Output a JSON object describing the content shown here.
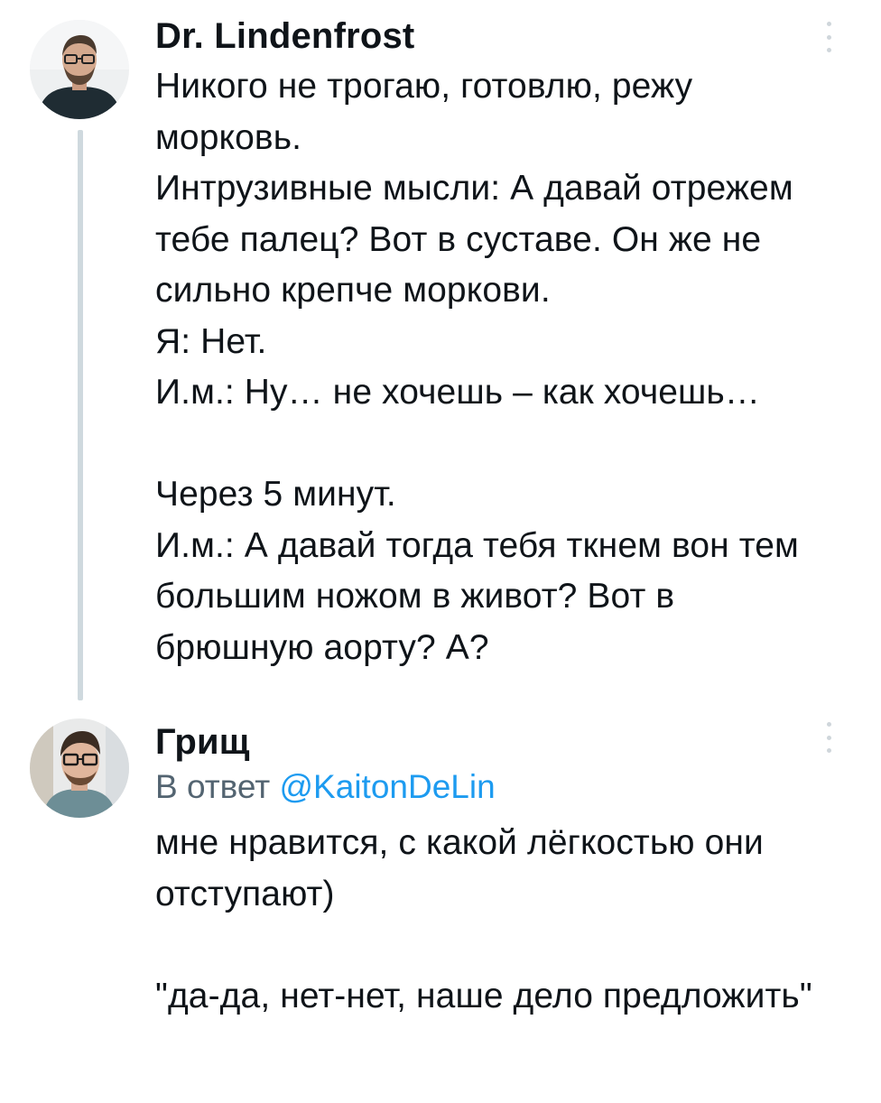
{
  "tweets": [
    {
      "author": "Dr. Lindenfrost",
      "text": "Никого не трогаю, готовлю, режу\nморковь.\nИнтрузивные мысли: А давай отрежем\nтебе палец? Вот в суставе. Он же не\nсильно крепче моркови.\nЯ: Нет.\nИ.м.: Ну… не хочешь – как хочешь…\n\nЧерез 5 минут.\nИ.м.: А давай тогда тебя ткнем вон тем\nбольшим ножом в живот? Вот в\nбрюшную аорту? А?",
      "more_icon": "more-vertical-icon"
    },
    {
      "author": "Грищ",
      "reply_prefix": "В ответ",
      "reply_handle": "@KaitonDeLin",
      "text": "мне нравится, с какой лёгкостью они\nотступают)\n\n\"да-да, нет-нет, наше дело предложить\"",
      "more_icon": "more-vertical-icon"
    }
  ],
  "colors": {
    "thread_line": "#cfd9de",
    "link": "#1d9bf0",
    "secondary_text": "#536471"
  }
}
